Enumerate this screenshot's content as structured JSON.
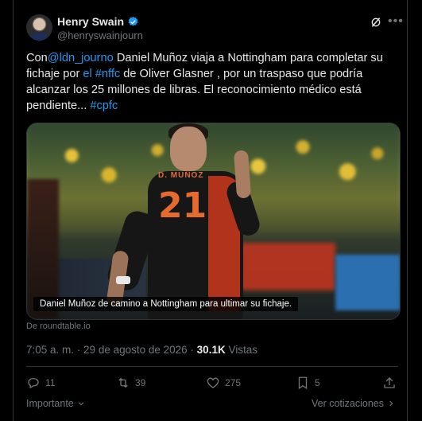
{
  "author": {
    "display_name": "Henry Swain",
    "handle": "@henryswainjourn"
  },
  "tweet": {
    "text_parts": [
      {
        "t": "Con",
        "link": false
      },
      {
        "t": "@ldn_journo",
        "link": true
      },
      {
        "t": "  Daniel Muñoz viaja a Nottingham para completar su fichaje por ",
        "link": false
      },
      {
        "t": "el #nffc",
        "link": true
      },
      {
        "t": " de Oliver Glasner , por un traspaso que podría alcanzar los 25 millones de libras. El reconocimiento médico está pendiente... ",
        "link": false
      },
      {
        "t": "#cpfc",
        "link": true
      }
    ]
  },
  "media": {
    "caption": "Daniel Muñoz de camino a Nottingham para ultimar su fichaje.",
    "jersey_name": "D. MUÑOZ",
    "jersey_number": "21",
    "source": "De roundtable.io"
  },
  "meta": {
    "time": "7:05 a. m.",
    "sep": " · ",
    "date": "29 de agosto de 2026",
    "views_count": "30.1K",
    "views_label": "Vistas"
  },
  "actions": {
    "replies": "11",
    "reposts": "39",
    "likes": "275",
    "bookmarks": "5"
  },
  "footer": {
    "important_label": "Importante",
    "quotes_label": "Ver cotizaciones"
  },
  "colors": {
    "background": "#000000",
    "text": "#e7e9ea",
    "muted": "#71767b",
    "link": "#1d9bf0",
    "verified": "#1d9bf0"
  },
  "icons": [
    "avatar",
    "verified-badge-icon",
    "grok-icon",
    "more-icon",
    "reply-icon",
    "repost-icon",
    "like-icon",
    "bookmark-icon",
    "share-icon",
    "chevron-down-icon",
    "chevron-right-icon"
  ]
}
